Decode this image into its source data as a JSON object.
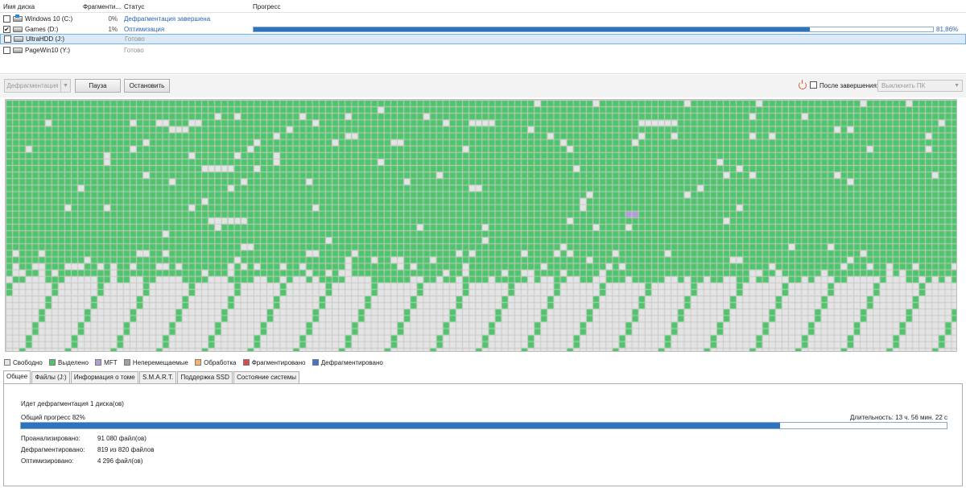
{
  "columns": {
    "name": "Имя диска",
    "fragmentation": "Фрагменти...",
    "status": "Статус",
    "progress": "Прогресс"
  },
  "disks": [
    {
      "name": "Windows 10 (C:)",
      "fragmentation": "0%",
      "status": "Дефрагментация завершена",
      "checked": false,
      "icon": "windows-drive-icon"
    },
    {
      "name": "Games (D:)",
      "fragmentation": "1%",
      "status": "Оптимизация",
      "checked": true,
      "progress_percent": "81,86%",
      "progress_fraction": 0.8186,
      "icon": "drive-icon"
    },
    {
      "name": "UltraHDD (J:)",
      "fragmentation": "",
      "status": "Готово",
      "checked": false,
      "selected": true,
      "icon": "drive-icon"
    },
    {
      "name": "PageWin10 (Y:)",
      "fragmentation": "",
      "status": "Готово",
      "checked": false,
      "icon": "drive-icon"
    }
  ],
  "toolbar": {
    "defrag_label": "Дефрагментация",
    "pause_label": "Пауза",
    "stop_label": "Остановить",
    "after_label": "После завершения:",
    "after_option": "Выключить ПК"
  },
  "legend": [
    {
      "label": "Свободно",
      "color": "#e4e4e4"
    },
    {
      "label": "Выделено",
      "color": "#4ec56b"
    },
    {
      "label": "MFT",
      "color": "#b39bd8"
    },
    {
      "label": "Неперемещаемые",
      "color": "#a0a0a0"
    },
    {
      "label": "Обработка",
      "color": "#f2b66a"
    },
    {
      "label": "Фрагментировано",
      "color": "#e04848"
    },
    {
      "label": "Дефрагментировано",
      "color": "#3f74d0"
    }
  ],
  "tabs": [
    "Общее",
    "Файлы (J:)",
    "Информация о томе",
    "S.M.A.R.T.",
    "Поддержка SSD",
    "Состояние системы"
  ],
  "summary": {
    "heading": "Идет дефрагментация 1 диска(ов)",
    "overall_progress_label": "Общий прогресс 82%",
    "overall_progress_fraction": 0.82,
    "duration": "Длительность: 13 ч. 56 мин. 22 с",
    "stats": [
      {
        "label": "Проанализировано:",
        "value": "91 080 файл(ов)"
      },
      {
        "label": "Дефрагментировано:",
        "value": "819 из 820 файлов"
      },
      {
        "label": "Оптимизировано:",
        "value": "4 296 файл(ов)"
      }
    ]
  },
  "colors": {
    "allocated": "#4ec56b",
    "free": "#e4e4e4",
    "mft": "#b39bd8",
    "accent": "#2e73c0"
  }
}
